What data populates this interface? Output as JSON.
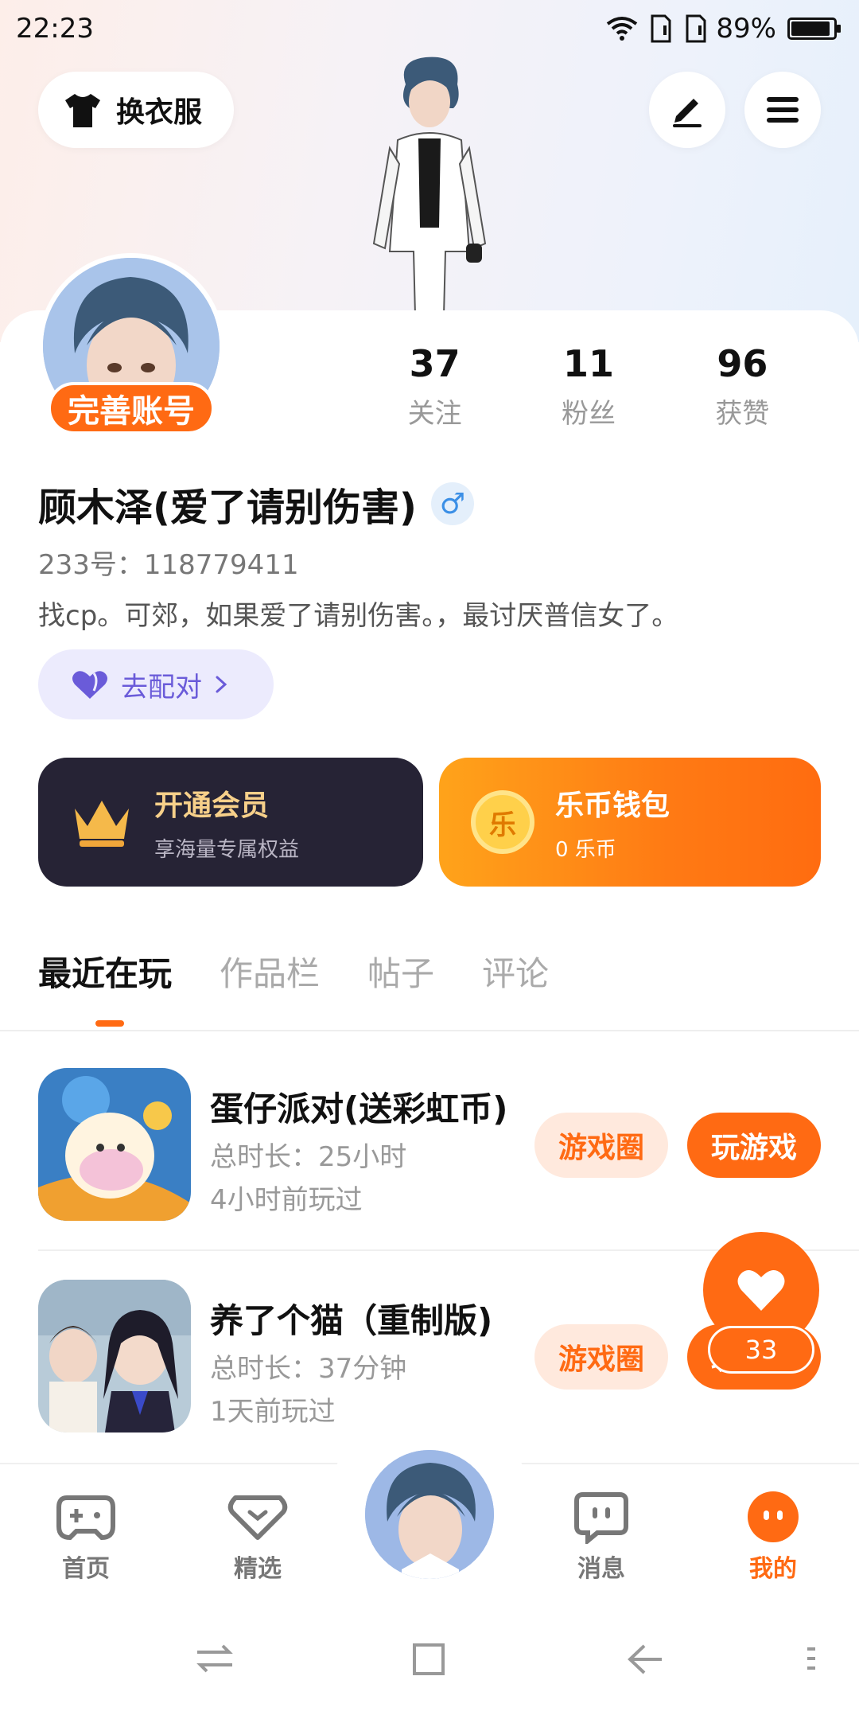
{
  "status_bar": {
    "time": "22:23",
    "battery": "89%",
    "battery_level": 0.89
  },
  "header": {
    "outfit_label": "换衣服"
  },
  "profile": {
    "complete_badge": "完善账号",
    "stats": [
      {
        "value": "37",
        "label": "关注"
      },
      {
        "value": "11",
        "label": "粉丝"
      },
      {
        "value": "96",
        "label": "获赞"
      }
    ],
    "username": "顾木泽(爱了请别伤害)",
    "gender_symbol": "♂",
    "uid": "233号：118779411",
    "bio": "找cp。可郊，如果爱了请别伤害。，最讨厌普信女了。",
    "match_label": "去配对"
  },
  "promo": {
    "vip_title": "开通会员",
    "vip_sub": "享海量专属权益",
    "wallet_title": "乐币钱包",
    "wallet_sub": "0 乐币",
    "coin_char": "乐"
  },
  "tabs": [
    "最近在玩",
    "作品栏",
    "帖子",
    "评论"
  ],
  "games": [
    {
      "name": "蛋仔派对(送彩虹币)",
      "duration": "总时长：25小时",
      "last_played": "4小时前玩过",
      "circle_label": "游戏圈",
      "play_label": "玩游戏"
    },
    {
      "name": "养了个猫（重制版)",
      "duration": "总时长：37分钟",
      "last_played": "1天前玩过",
      "circle_label": "游戏圈",
      "play_label": "玩游戏"
    }
  ],
  "like_count": "33",
  "bottom_nav": [
    {
      "label": "首页"
    },
    {
      "label": "精选"
    },
    {
      "label": "消息"
    },
    {
      "label": "我的"
    }
  ],
  "colors": {
    "accent": "#ff6a13",
    "vip_bg": "#262335",
    "match_text": "#6a5bd9"
  }
}
